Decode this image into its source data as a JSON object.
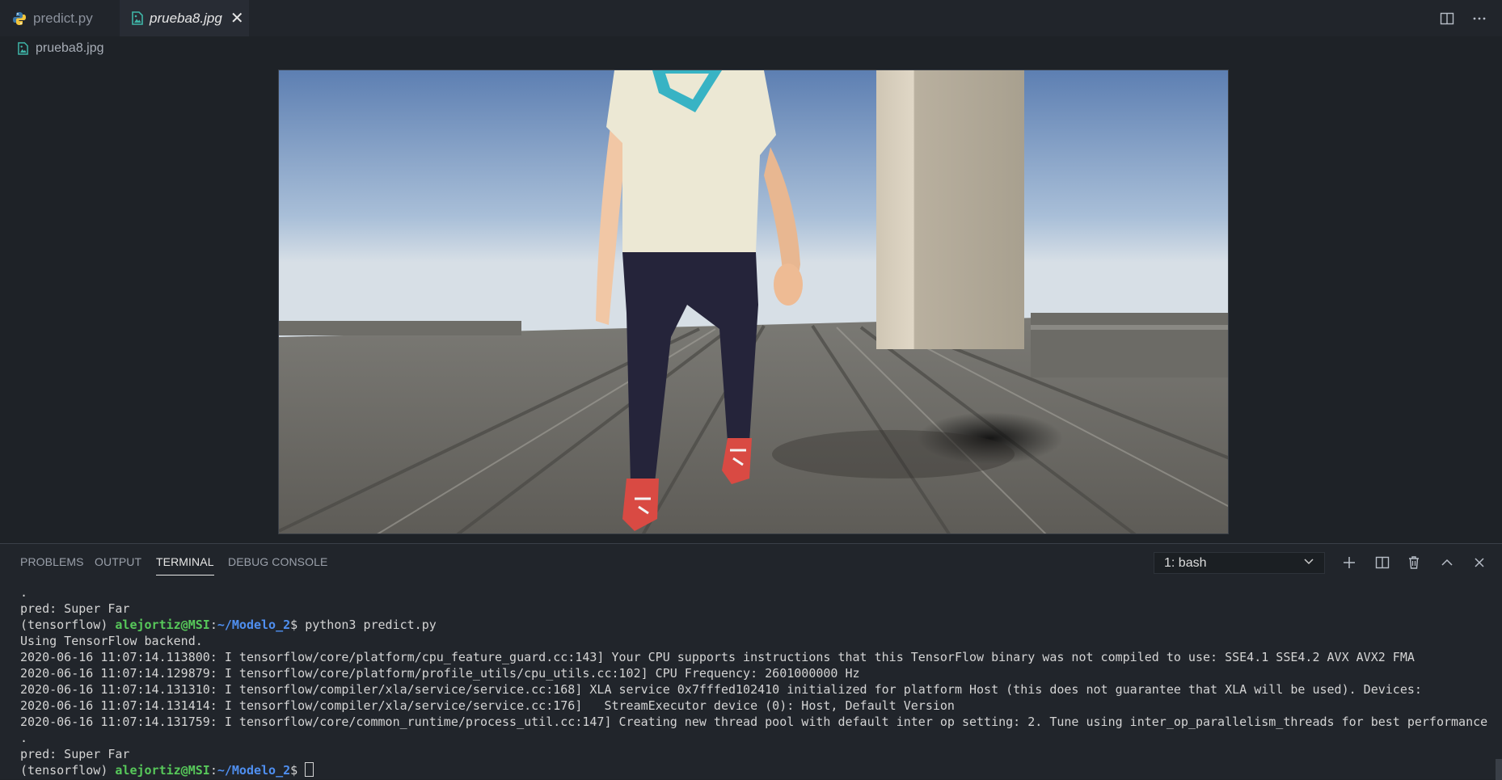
{
  "tabs": [
    {
      "label": "predict.py",
      "icon": "python-icon",
      "active": false
    },
    {
      "label": "prueba8.jpg",
      "icon": "image-file-icon",
      "active": true
    }
  ],
  "editor_actions": {
    "split": "split-editor-icon",
    "more": "ellipsis-icon"
  },
  "breadcrumb": {
    "label": "prueba8.jpg",
    "icon": "image-file-icon"
  },
  "panel": {
    "tabs": [
      "PROBLEMS",
      "OUTPUT",
      "TERMINAL",
      "DEBUG CONSOLE"
    ],
    "active_tab": "TERMINAL",
    "shell": "1: bash",
    "actions": [
      "plus-icon",
      "split-terminal-icon",
      "trash-icon",
      "chevron-up-icon",
      "close-icon"
    ]
  },
  "terminal": {
    "lines": [
      {
        "type": "text",
        "text": "."
      },
      {
        "type": "text",
        "text": "pred: Super Far"
      },
      {
        "type": "prompt",
        "env": "(tensorflow) ",
        "user": "alejortiz@MSI",
        "sep": ":",
        "path": "~/Modelo_2",
        "suffix": "$ ",
        "command": "python3 predict.py"
      },
      {
        "type": "text",
        "text": "Using TensorFlow backend."
      },
      {
        "type": "text",
        "text": "2020-06-16 11:07:14.113800: I tensorflow/core/platform/cpu_feature_guard.cc:143] Your CPU supports instructions that this TensorFlow binary was not compiled to use: SSE4.1 SSE4.2 AVX AVX2 FMA"
      },
      {
        "type": "text",
        "text": "2020-06-16 11:07:14.129879: I tensorflow/core/platform/profile_utils/cpu_utils.cc:102] CPU Frequency: 2601000000 Hz"
      },
      {
        "type": "text",
        "text": "2020-06-16 11:07:14.131310: I tensorflow/compiler/xla/service/service.cc:168] XLA service 0x7fffed102410 initialized for platform Host (this does not guarantee that XLA will be used). Devices:"
      },
      {
        "type": "text",
        "text": "2020-06-16 11:07:14.131414: I tensorflow/compiler/xla/service/service.cc:176]   StreamExecutor device (0): Host, Default Version"
      },
      {
        "type": "text",
        "text": "2020-06-16 11:07:14.131759: I tensorflow/core/common_runtime/process_util.cc:147] Creating new thread pool with default inter op setting: 2. Tune using inter_op_parallelism_threads for best performance"
      },
      {
        "type": "text",
        "text": "."
      },
      {
        "type": "text",
        "text": "pred: Super Far"
      },
      {
        "type": "prompt",
        "env": "(tensorflow) ",
        "user": "alejortiz@MSI",
        "sep": ":",
        "path": "~/Modelo_2",
        "suffix": "$ ",
        "command": "",
        "cursor": true
      }
    ]
  },
  "colors": {
    "user": "#57c85a",
    "path": "#4f8ff0",
    "python_icon": "#3b77a8",
    "image_icon": "#3fb6a8"
  }
}
